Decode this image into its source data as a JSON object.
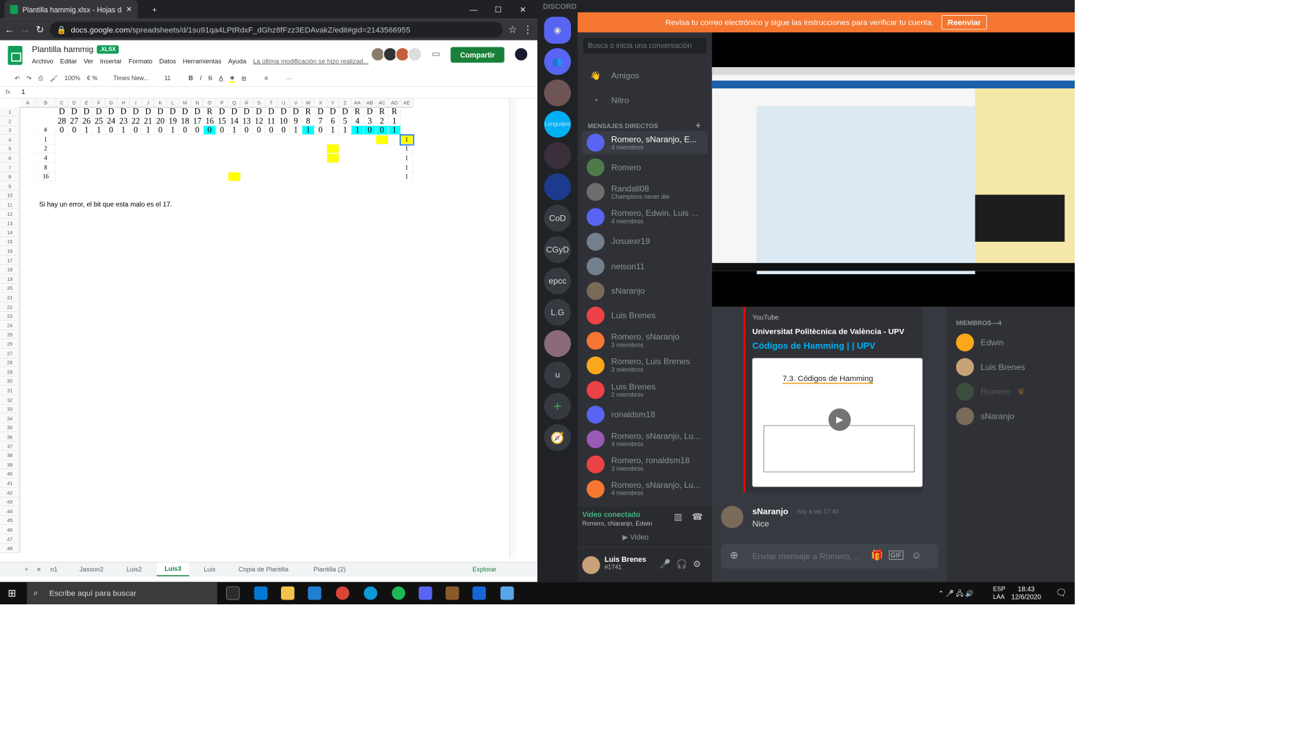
{
  "chrome": {
    "tab_title": "Plantilla hammig.xlsx - Hojas de c",
    "url_domain": "docs.google.com",
    "url_path": "/spreadsheets/d/1su91qa4LPtRdxF_dGhz8fFzz3EDAvakZ/edit#gid=2143566955"
  },
  "sheets": {
    "title": "Plantilla hammig",
    "badge": ".XLSX",
    "menu": [
      "Archivo",
      "Editar",
      "Ver",
      "Insertar",
      "Formato",
      "Datos",
      "Herramientas",
      "Ayuda"
    ],
    "last_edit": "La última modificación se hizo realizad...",
    "share_label": "Compartir",
    "zoom": "100%",
    "font": "Times New...",
    "font_size": "11",
    "formula_ref": "fx",
    "formula_value": "1",
    "columns": [
      "A",
      "B",
      "C",
      "D",
      "E",
      "F",
      "G",
      "H",
      "I",
      "J",
      "K",
      "L",
      "M",
      "N",
      "O",
      "P",
      "Q",
      "R",
      "S",
      "T",
      "U",
      "V",
      "W",
      "X",
      "Y",
      "Z",
      "AA",
      "AB",
      "AC",
      "AD",
      "AE"
    ],
    "row_numbers": [
      "1",
      "2",
      "3",
      "4",
      "5",
      "6",
      "7",
      "8",
      "9",
      "10",
      "11",
      "12",
      "13",
      "14",
      "15",
      "16",
      "17",
      "18",
      "19",
      "20",
      "21",
      "22",
      "23",
      "24",
      "25",
      "26",
      "27",
      "28",
      "29",
      "30",
      "31",
      "32",
      "33",
      "34",
      "35",
      "36",
      "37",
      "38",
      "39",
      "40",
      "41",
      "42",
      "43",
      "44",
      "45",
      "46",
      "47",
      "48"
    ],
    "row1": [
      "D",
      "D",
      "D",
      "D",
      "D",
      "D",
      "D",
      "D",
      "D",
      "D",
      "D",
      "D",
      "R",
      "D",
      "D",
      "D",
      "D",
      "D",
      "D",
      "D",
      "R",
      "D",
      "D",
      "D",
      "R",
      "D",
      "R",
      "R"
    ],
    "row2": [
      "28",
      "27",
      "26",
      "25",
      "24",
      "23",
      "22",
      "21",
      "20",
      "19",
      "18",
      "17",
      "16",
      "15",
      "14",
      "13",
      "12",
      "11",
      "10",
      "9",
      "8",
      "7",
      "6",
      "5",
      "4",
      "3",
      "2",
      "1"
    ],
    "row3_label": "#",
    "row3": [
      "0",
      "0",
      "1",
      "1",
      "0",
      "1",
      "0",
      "1",
      "0",
      "1",
      "0",
      "0",
      "0",
      "0",
      "1",
      "0",
      "0",
      "0",
      "0",
      "1",
      "1",
      "0",
      "1",
      "1",
      "1",
      "0",
      "0",
      "1"
    ],
    "row_labels": [
      "1",
      "2",
      "4",
      "8",
      "16"
    ],
    "note": "Si hay un error, el bit que esta malo es el 17.",
    "tabs": [
      "n1",
      "Jasson2",
      "Luis2",
      "Luis3",
      "Luis",
      "Copia de Plantilla",
      "Plantilla (2)"
    ],
    "explore": "Explorar"
  },
  "discord": {
    "brand": "DISCORD",
    "banner_text": "Revisa tu correo electrónico y sigue las instrucciones para verificar tu cuenta.",
    "banner_button": "Reenviar",
    "search_placeholder": "Busca o inicia una conversación",
    "friends": "Amigos",
    "nitro": "Nitro",
    "dm_header": "MENSAJES DIRECTOS",
    "servers": [
      "Lenguajes",
      "CoD",
      "CGyD",
      "epcc",
      "L.G",
      "u"
    ],
    "dms": [
      {
        "name": "Romero, sNaranjo, E...",
        "sub": "4 miembros",
        "color": "#5865f2"
      },
      {
        "name": "Romero",
        "sub": "",
        "color": "#4e7a4a"
      },
      {
        "name": "Randall08",
        "sub": "Champions never die",
        "color": "#6d6d6d"
      },
      {
        "name": "Romero, Edwin, Luis ...",
        "sub": "4 miembros",
        "color": "#5865f2"
      },
      {
        "name": "Josuexr19",
        "sub": "",
        "color": "#747f8d"
      },
      {
        "name": "nelson11",
        "sub": "",
        "color": "#747f8d"
      },
      {
        "name": "sNaranjo",
        "sub": "",
        "color": "#7a6a5a"
      },
      {
        "name": "Luis Brenes",
        "sub": "",
        "color": "#ed4245"
      },
      {
        "name": "Romero, sNaranjo",
        "sub": "3 miembros",
        "color": "#f57731"
      },
      {
        "name": "Romero, Luis Brenes",
        "sub": "3 miembros",
        "color": "#faa81a"
      },
      {
        "name": "Luis Brenes",
        "sub": "2 miembros",
        "color": "#ed4245"
      },
      {
        "name": "ronaldsm18",
        "sub": "",
        "color": "#5865f2"
      },
      {
        "name": "Romero, sNaranjo, Lu...",
        "sub": "4 miembros",
        "color": "#9b59b6"
      },
      {
        "name": "Romero, ronaldsm18",
        "sub": "3 miembros",
        "color": "#ed4245"
      },
      {
        "name": "Romero, sNaranjo, Lu...",
        "sub": "4 miembros",
        "color": "#f57731"
      }
    ],
    "voice_status": "Video conectado",
    "voice_members": "Romero, sNaranjo, Edwin",
    "video_label": "Video",
    "user_name": "Luis Brenes",
    "user_tag": "#1741",
    "embed_provider": "YouTube",
    "embed_author": "Universitat Politècnica de València - UPV",
    "embed_title": "Códigos de Hamming |  | UPV",
    "embed_slide_title": "7.3. Códigos de Hamming",
    "message_author": "sNaranjo",
    "message_time": "hoy a las 17:40",
    "message_text": "Nice",
    "input_placeholder": "Enviar mensaje a Romero, ...",
    "members_header": "MIEMBROS—4",
    "members": [
      "Edwin",
      "Luis Brenes",
      "Romero",
      "sNaranjo"
    ]
  },
  "taskbar": {
    "search": "Escribe aquí para buscar",
    "lang": "ESP",
    "lang2": "LAA",
    "time": "18:43",
    "date": "12/6/2020"
  }
}
